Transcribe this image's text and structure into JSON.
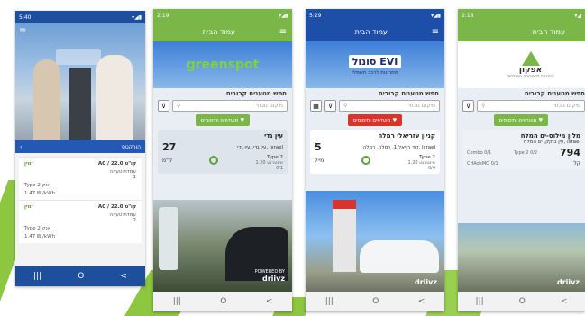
{
  "screens": {
    "evdrive": {
      "time": "5:40",
      "back_label": "הורקטס",
      "items": [
        {
          "power": "AC / 22.0 קו\"ט",
          "status": "זמין",
          "line1": "עמדת טעינה",
          "num": "1",
          "connector": "Type 2 אנק",
          "price": "1.47 ₪ /kWh"
        },
        {
          "power": "AC / 22.0 קו\"ט",
          "status": "זמין",
          "line1": "עמדת טעינה",
          "num": "2",
          "connector": "Type 2 אנק",
          "price": "1.47 ₪ /kWh"
        }
      ]
    },
    "greenspot": {
      "time": "2:19",
      "header": "עמוד הבית",
      "logo": "greenspot",
      "search_title": "חפש מטענים קרובים",
      "search_placeholder": "מיקום נוכחי",
      "favorites": "מועדפים ותיסומים",
      "card": {
        "name": "עין גדי",
        "address": "עין גדי, עין גדי, Israel",
        "distance": "27",
        "unit": "ק\"מ",
        "connector": "Type 2",
        "connector_sub": "1.20 אינטרנט",
        "count": "0/1"
      },
      "powered": "POWERED BY",
      "brand": "driivz"
    },
    "sonol": {
      "time": "5:29",
      "header": "עמוד הבית",
      "logo": "סונול EVI",
      "logo_sub": "פתרונות לרכב חשמלי",
      "search_title": "חפש מטענים קרובים",
      "search_placeholder": "מיקום נוכחי",
      "favorites": "מועדפים ותיסומים",
      "card": {
        "name": "קניון עזריאלי רמלה",
        "address": "דוד רזיאל 1, רמלה, רמלה, Israel",
        "distance": "5",
        "unit": "מייל",
        "connector": "Type 2",
        "connector_sub": "1.20 אינטרנט",
        "count": "0/4"
      },
      "brand": "driivz"
    },
    "afcon": {
      "time": "2:18",
      "header": "עמוד הבית",
      "logo": "אפקון",
      "logo_sub": "החברה לתחבורה חשמלית",
      "search_title": "חפש מטענים קרובים",
      "search_placeholder": "מיקום נוכחי",
      "favorites": "מועדפים ותיסומים",
      "card": {
        "name": "מלון מילוס-ים המלח",
        "address": "עין בוקק, ים המלח, Israel",
        "distance": "794",
        "unit": "קל",
        "connectors": [
          {
            "name": "Combo",
            "count": "0/1"
          },
          {
            "name": "Type 2",
            "count": "0/2"
          },
          {
            "name": "CHAdeMO",
            "count": "0/1"
          }
        ]
      },
      "brand": "driivz"
    }
  },
  "nav": {
    "recent": "|||",
    "home": "O",
    "back": "<"
  },
  "colors": {
    "blue": "#2458b5",
    "green": "#7ab648",
    "red": "#d9342b",
    "gray": "#e9eef4"
  }
}
